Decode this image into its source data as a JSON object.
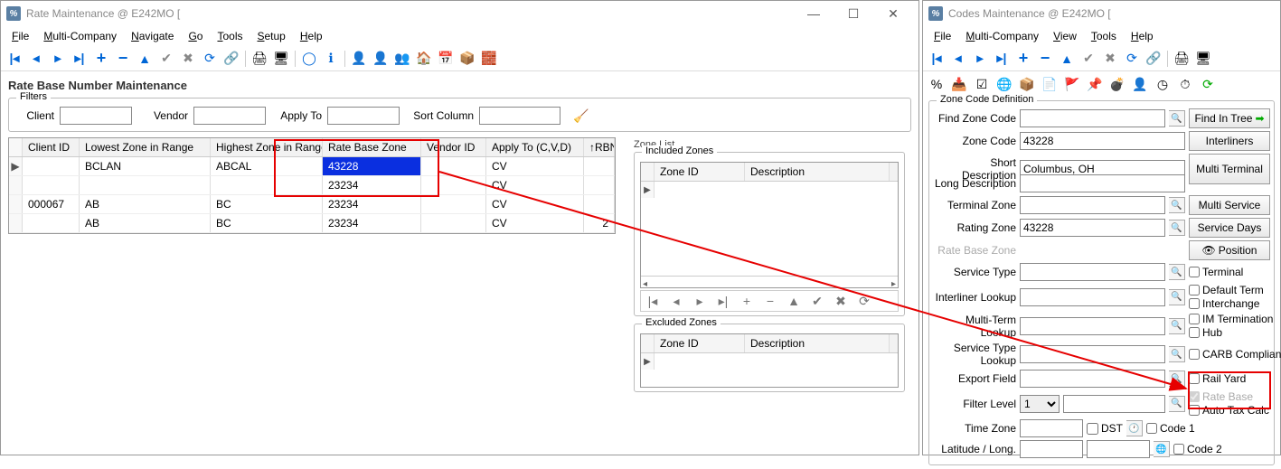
{
  "left": {
    "title": "Rate Maintenance @ E242MO [",
    "menu": [
      "File",
      "Multi-Company",
      "Navigate",
      "Go",
      "Tools",
      "Setup",
      "Help"
    ],
    "page_title": "Rate Base Number Maintenance",
    "filters": {
      "legend": "Filters",
      "client_lbl": "Client",
      "vendor_lbl": "Vendor",
      "apply_lbl": "Apply To",
      "sort_lbl": "Sort Column"
    },
    "grid": {
      "headers": [
        "Client ID",
        "Lowest Zone in Range",
        "Highest Zone in Range",
        "Rate Base Zone",
        "Vendor ID",
        "Apply To (C,V,D)",
        "↑RBN"
      ],
      "rows": [
        {
          "client": "",
          "low": "BCLAN",
          "high": "ABCAL",
          "rate": "43228",
          "vendor": "",
          "apply": "CV",
          "rbn": ""
        },
        {
          "client": "",
          "low": "",
          "high": "",
          "rate": "23234",
          "vendor": "",
          "apply": "CV",
          "rbn": ""
        },
        {
          "client": "000067",
          "low": "AB",
          "high": "BC",
          "rate": "23234",
          "vendor": "",
          "apply": "CV",
          "rbn": ""
        },
        {
          "client": "",
          "low": "AB",
          "high": "BC",
          "rate": "23234",
          "vendor": "",
          "apply": "CV",
          "rbn": "2"
        }
      ]
    },
    "zone_list": {
      "label": "Zone List",
      "included": "Included Zones",
      "excluded": "Excluded Zones",
      "cols": [
        "Zone ID",
        "Description"
      ]
    }
  },
  "right": {
    "title": "Codes Maintenance @ E242MO [",
    "menu": [
      "File",
      "Multi-Company",
      "View",
      "Tools",
      "Help"
    ],
    "fieldset_legend": "Zone Code Definition",
    "labels": {
      "find": "Find Zone Code",
      "zone": "Zone Code",
      "sdesc": "Short Description",
      "ldesc": "Long Description",
      "tzone": "Terminal Zone",
      "rzone": "Rating Zone",
      "rbzone": "Rate Base Zone",
      "stype": "Service Type",
      "ilook": "Interliner Lookup",
      "mtlook": "Multi-Term Lookup",
      "stlook": "Service Type Lookup",
      "export": "Export Field",
      "flevel": "Filter Level",
      "tz": "Time Zone",
      "latlon": "Latitude / Long."
    },
    "values": {
      "zone": "43228",
      "sdesc": "Columbus, OH",
      "rzone": "43228",
      "flevel": "1"
    },
    "buttons": {
      "find_tree": "Find In Tree",
      "interliners": "Interliners",
      "multi_term": "Multi Terminal",
      "multi_serv": "Multi Service",
      "serv_days": "Service Days",
      "position": "Position"
    },
    "checks": {
      "terminal": "Terminal",
      "defterm": "Default Term",
      "interchange": "Interchange",
      "imterm": "IM Termination",
      "hub": "Hub",
      "carb": "CARB Compliant",
      "railyard": "Rail Yard",
      "ratebase": "Rate Base",
      "autotax": "Auto Tax Calc",
      "code1": "Code 1",
      "code2": "Code 2",
      "dst": "DST"
    }
  }
}
